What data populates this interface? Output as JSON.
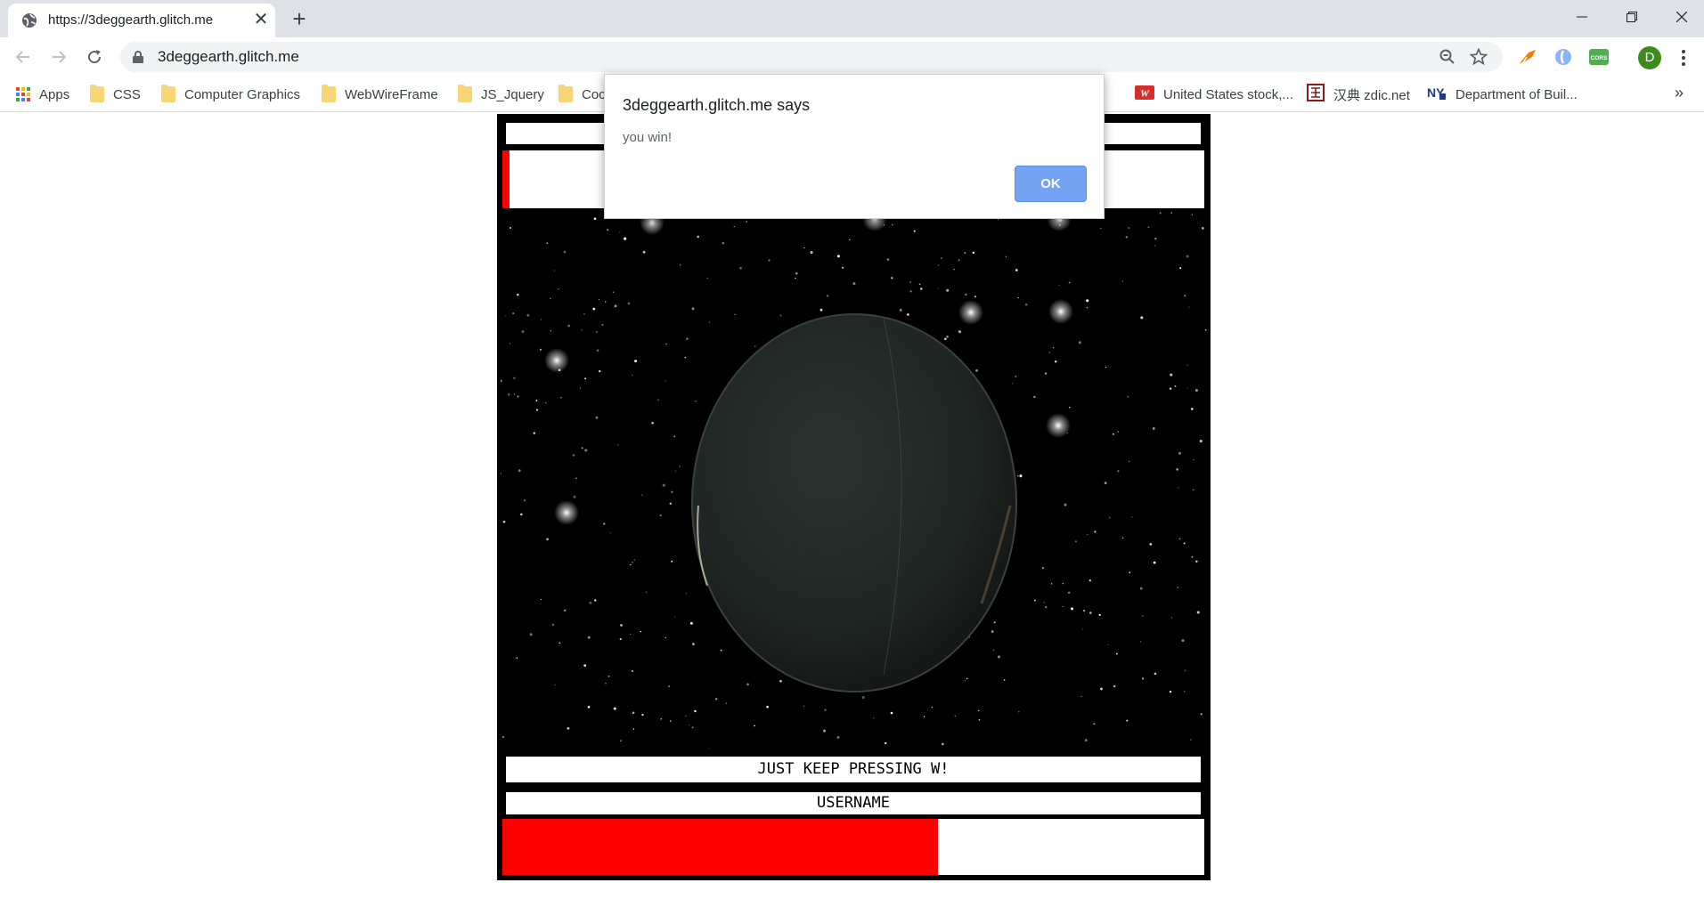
{
  "browser": {
    "tab": {
      "title": "https://3deggearth.glitch.me"
    },
    "url": "3deggearth.glitch.me",
    "profile_initial": "D",
    "bookmarks": [
      {
        "label": "Apps",
        "icon": "apps-grid-icon"
      },
      {
        "label": "CSS",
        "icon": "folder-icon"
      },
      {
        "label": "Computer Graphics",
        "icon": "folder-icon"
      },
      {
        "label": "WebWireFrame",
        "icon": "folder-icon"
      },
      {
        "label": "JS_Jquery",
        "icon": "folder-icon"
      },
      {
        "label": "Coc",
        "icon": "folder-icon"
      },
      {
        "label": "United States stock,...",
        "icon": "wsj-icon"
      },
      {
        "label": "汉典 zdic.net",
        "icon": "zdic-icon"
      },
      {
        "label": "Department of Buil...",
        "icon": "nyc-icon"
      }
    ],
    "bookmarks_more": "»",
    "extension_labels": {
      "cors": "CORS"
    }
  },
  "alert": {
    "title": "3deggearth.glitch.me says",
    "message": "you win!",
    "ok_label": "OK"
  },
  "game": {
    "instruction": "JUST KEEP PRESSING W!",
    "username_label": "USERNAME",
    "progress_fraction": 0.62,
    "colors": {
      "accent": "#ff0000",
      "background": "#000000",
      "panel": "#ffffff"
    }
  }
}
